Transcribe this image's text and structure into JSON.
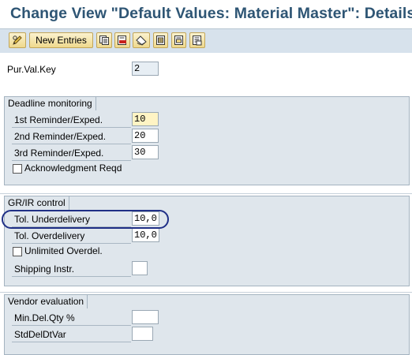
{
  "window": {
    "title": "Change View \"Default Values: Material Master\": Details"
  },
  "toolbar": {
    "buttons": [
      {
        "name": "display-change-icon"
      },
      {
        "label": "New Entries"
      },
      {
        "name": "copy-icon"
      },
      {
        "name": "delete-icon"
      },
      {
        "name": "undo-change-icon"
      },
      {
        "name": "select-all-icon"
      },
      {
        "name": "select-block-icon"
      },
      {
        "name": "deselect-all-icon"
      }
    ]
  },
  "header": {
    "pur_val_key": {
      "label": "Pur.Val.Key",
      "value": "2"
    }
  },
  "deadline_monitoring": {
    "title": "Deadline monitoring",
    "reminder1": {
      "label": "1st Reminder/Exped.",
      "value": "10"
    },
    "reminder2": {
      "label": "2nd Reminder/Exped.",
      "value": "20"
    },
    "reminder3": {
      "label": "3rd Reminder/Exped.",
      "value": "30"
    },
    "ack_reqd": {
      "label": "Acknowledgment Reqd",
      "checked": false
    }
  },
  "grir_control": {
    "title": "GR/IR control",
    "tol_under": {
      "label": "Tol. Underdelivery",
      "value": "10,0"
    },
    "tol_over": {
      "label": "Tol. Overdelivery",
      "value": "10,0"
    },
    "unlimited_overdel": {
      "label": "Unlimited Overdel.",
      "checked": false
    },
    "shipping_instr": {
      "label": "Shipping Instr.",
      "value": ""
    }
  },
  "vendor_evaluation": {
    "title": "Vendor evaluation",
    "min_del_qty": {
      "label": "Min.Del.Qty %",
      "value": ""
    },
    "std_del_dt_var": {
      "label": "StdDelDtVar",
      "value": ""
    }
  }
}
